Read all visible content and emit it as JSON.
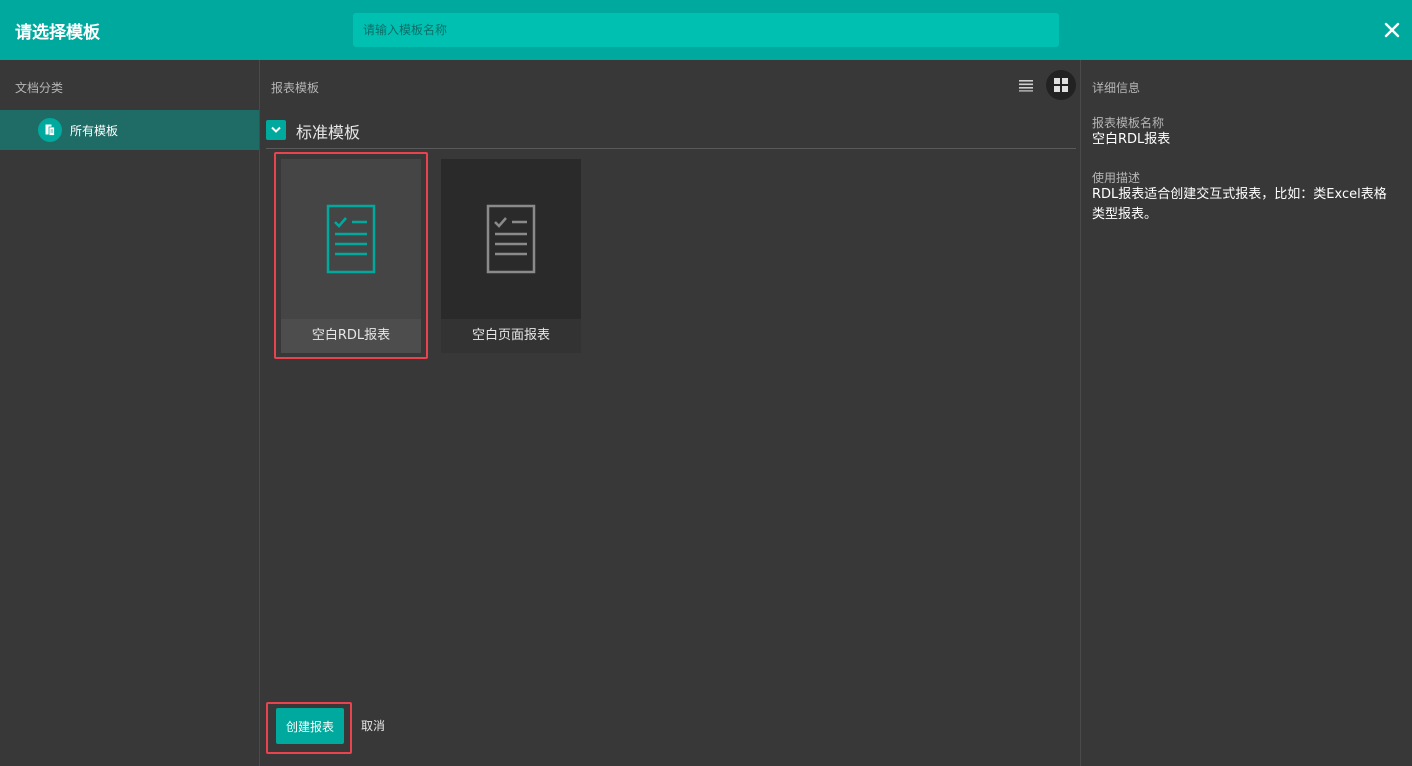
{
  "header": {
    "title": "请选择模板",
    "search_placeholder": "请输入模板名称",
    "close_icon": "close-icon"
  },
  "sidebar": {
    "title": "文档分类",
    "items": [
      {
        "label": "所有模板",
        "icon": "document-icon",
        "selected": true
      }
    ]
  },
  "main": {
    "title": "报表模板",
    "view_modes": [
      "list",
      "grid"
    ],
    "active_view": "grid",
    "group": {
      "title": "标准模板",
      "expanded": true,
      "templates": [
        {
          "label": "空白RDL报表",
          "icon": "report-document-icon",
          "selected": true,
          "icon_color": "#00a99d"
        },
        {
          "label": "空白页面报表",
          "icon": "report-document-icon",
          "selected": false,
          "icon_color": "#8a8a8a"
        }
      ]
    },
    "actions": {
      "create_label": "创建报表",
      "cancel_label": "取消"
    }
  },
  "details": {
    "title": "详细信息",
    "name_label": "报表模板名称",
    "name_value": "空白RDL报表",
    "desc_label": "使用描述",
    "desc_value": "RDL报表适合创建交互式报表，比如：类Excel表格类型报表。"
  },
  "colors": {
    "accent": "#00a99d",
    "header_search_bg": "#00c0b2",
    "highlight": "#e8434f",
    "background": "#383838"
  }
}
